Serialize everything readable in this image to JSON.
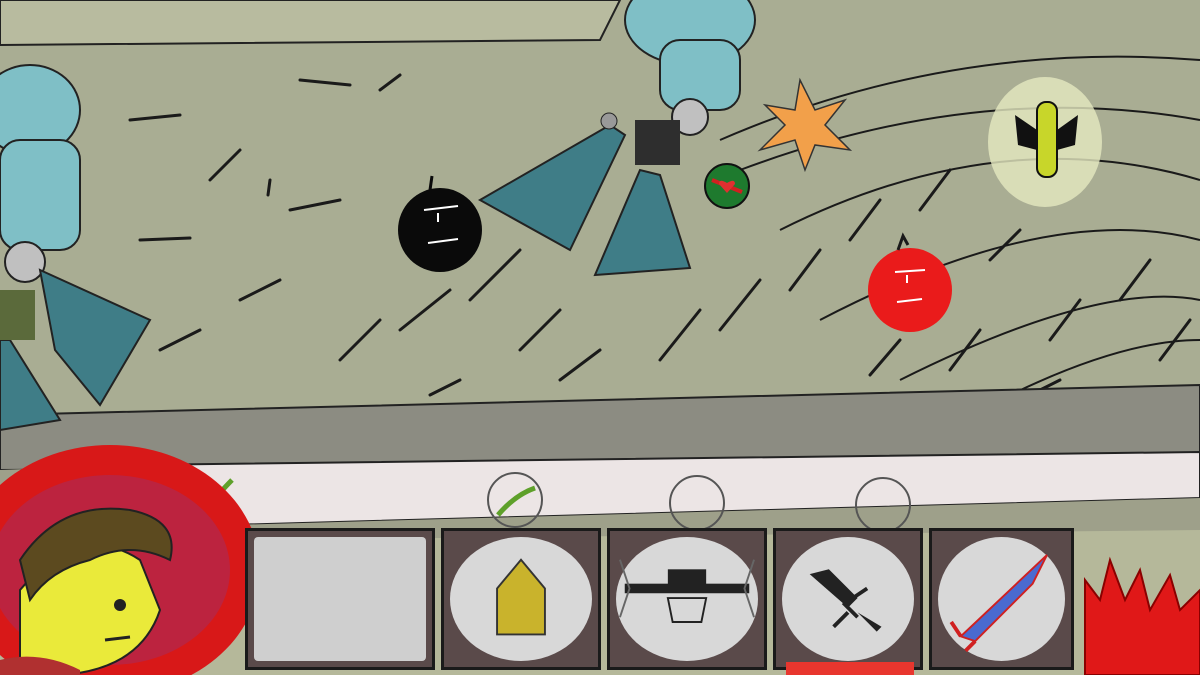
{
  "game": {
    "colors": {
      "background": "#b5b89a",
      "ground": "#9ea08a",
      "road": "#8a8a80",
      "sidewalk": "#ebe4e4",
      "enemy_black": "#0a0a0a",
      "enemy_red": "#ea1b1b",
      "player_aura": "#e01818",
      "fire": "#e01818",
      "cooldown": "#e8362e"
    },
    "entities": [
      {
        "name": "robot-walker-left",
        "icon": "tripod-robot-icon"
      },
      {
        "name": "robot-walker-center",
        "icon": "tripod-robot-icon"
      },
      {
        "name": "black-bomb-enemy",
        "icon": "black-bomb-face-icon"
      },
      {
        "name": "red-bomb-enemy",
        "icon": "red-bomb-face-icon"
      },
      {
        "name": "health-orb-pickup",
        "icon": "heart-orb-icon"
      },
      {
        "name": "explosion-effect",
        "icon": "explosion-icon"
      },
      {
        "name": "rocket-powerup",
        "icon": "rocket-bubble-icon"
      }
    ],
    "hotbar": {
      "slots": [
        {
          "name": "empty",
          "icon": "empty-slot"
        },
        {
          "name": "bullet",
          "icon": "bullet-icon"
        },
        {
          "name": "crossbow",
          "icon": "crossbow-icon"
        },
        {
          "name": "sword",
          "icon": "sword-icon"
        },
        {
          "name": "rocket",
          "icon": "rocket-icon"
        }
      ],
      "selected_index": 3,
      "cooldown_fraction": 1.0
    },
    "ammo_indicators": [
      {
        "name": "ammo-ring-1",
        "filled": true
      },
      {
        "name": "ammo-ring-2",
        "filled": true
      },
      {
        "name": "ammo-ring-3",
        "filled": false
      },
      {
        "name": "ammo-ring-4",
        "filled": false
      }
    ]
  }
}
